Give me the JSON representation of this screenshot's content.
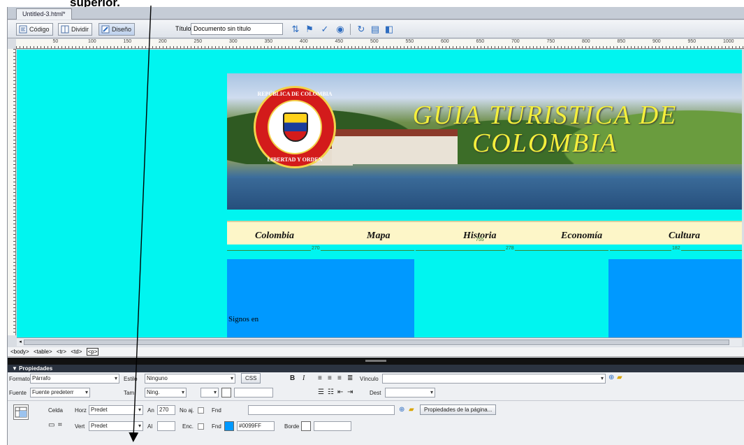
{
  "annotation": {
    "text": "superior."
  },
  "document": {
    "tab_label": "Untitled-3.html*"
  },
  "toolbar": {
    "code_label": "Código",
    "split_label": "Dividir",
    "design_label": "Diseño",
    "title_label": "Título:",
    "title_value": "Documento sin título"
  },
  "ruler": {
    "marks": [
      "50",
      "100",
      "150",
      "200",
      "250",
      "300",
      "350",
      "400",
      "450",
      "500",
      "550",
      "600",
      "650",
      "700",
      "750",
      "800",
      "850",
      "900",
      "950",
      "1000"
    ]
  },
  "page": {
    "banner_title": "GUIA TURISTICA DE COLOMBIA",
    "seal_top_text": "REPÚBLICA DE COLOMBIA",
    "seal_bottom_text": "LIBERTAD Y ORDEN",
    "menu": [
      "Colombia",
      "Mapa",
      "Historia",
      "Economía",
      "Cultura"
    ],
    "table_width_label": "755",
    "column_widths": [
      "270",
      "278",
      "182"
    ],
    "cell_text": "Signos en"
  },
  "tag_selector": [
    "<body>",
    "<table>",
    "<tr>",
    "<td>",
    "<p>"
  ],
  "properties": {
    "header": "▼ Propiedades",
    "formato_label": "Formato",
    "formato_value": "Párrafo",
    "estilo_label": "Estilo",
    "estilo_value": "Ninguno",
    "css_button": "CSS",
    "bold": "B",
    "italic": "I",
    "vinculo_label": "Vínculo",
    "fuente_label": "Fuente",
    "fuente_value": "Fuente predeterr",
    "tam_label": "Tam",
    "tam_value": "Ning.",
    "dest_label": "Dest",
    "celda_label": "Celda",
    "horz_label": "Horz",
    "horz_value": "Predet",
    "an_label": "An",
    "an_value": "270",
    "noaj_label": "No aj.",
    "fnd_label": "Fnd",
    "page_props_button": "Propiedades de la página...",
    "vert_label": "Vert",
    "vert_value": "Predet",
    "al_label": "Al",
    "enc_label": "Enc.",
    "fnd2_label": "Fnd",
    "fnd_color_value": "#0099FF",
    "fnd_color": "#0099ff",
    "borde_label": "Borde"
  },
  "colors": {
    "canvas_bg": "#00f5f0",
    "cell_blue": "#0099ff",
    "menu_bg": "#fdf6c8",
    "title_yellow": "#f4ef3c"
  }
}
